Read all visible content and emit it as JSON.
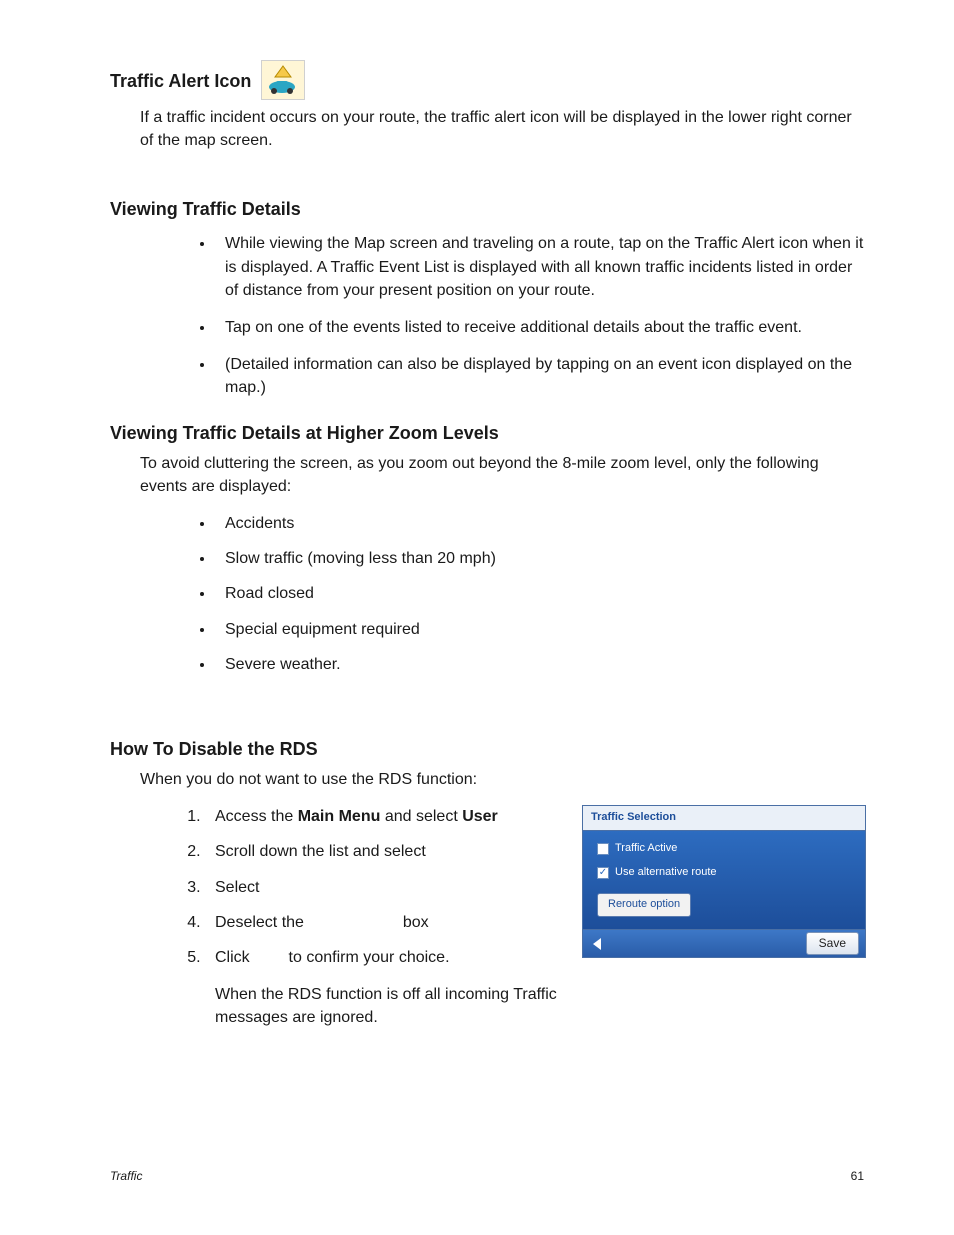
{
  "s1": {
    "heading": "Traffic Alert Icon",
    "para": "If a traffic incident occurs on your route, the traffic alert icon will be displayed in the lower right corner of the map screen."
  },
  "s2": {
    "heading": "Viewing Traffic Details",
    "b1": "While viewing the Map screen and traveling on a route, tap on the Traffic Alert icon when it is displayed.  A Traffic Event List is displayed with all known traffic incidents listed in order of distance from your present position on your route.",
    "b2": "Tap on one of the events listed to receive additional details about the traffic event.",
    "b3": "(Detailed information can also be displayed by tapping on an event icon displayed on the map.)"
  },
  "s3": {
    "heading": "Viewing Traffic Details at Higher Zoom Levels",
    "intro": "To avoid cluttering the screen, as you zoom out beyond the 8-mile zoom level, only the following events are displayed:",
    "items": {
      "i1": "Accidents",
      "i2": "Slow traffic (moving less than 20 mph)",
      "i3": "Road closed",
      "i4": "Special equipment required",
      "i5": "Severe weather."
    }
  },
  "s4": {
    "heading": "How To Disable the RDS",
    "intro": "When you do not want to use the RDS function:",
    "step1_a": "Access the ",
    "step1_b": "Main Menu",
    "step1_c": " and select ",
    "step1_d": "User",
    "step2": "Scroll down the list and select",
    "step3": "Select",
    "step4_a": "Deselect the ",
    "step4_b": " box",
    "step5_a": "Click ",
    "step5_b": " to confirm your choice.",
    "note": "When the RDS function is off all incoming Traffic messages are ignored."
  },
  "panel": {
    "title": "Traffic Selection",
    "row1": "Traffic Active",
    "row2": "Use alternative route",
    "reroute": "Reroute option",
    "save": "Save",
    "checkmark": "✓"
  },
  "footer": {
    "left": "Traffic",
    "right": "61"
  }
}
